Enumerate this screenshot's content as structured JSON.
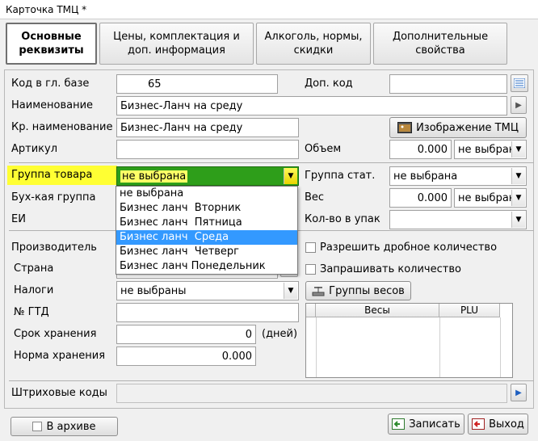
{
  "window": {
    "title": "Карточка ТМЦ *"
  },
  "tabs": [
    {
      "label_1": "Основные",
      "label_2": "реквизиты"
    },
    {
      "label_1": "Цены, комплектация и",
      "label_2": "доп.  информация"
    },
    {
      "label_1": "Алкоголь, нормы,",
      "label_2": "скидки"
    },
    {
      "label_1": "Дополнительные",
      "label_2": "свойства"
    }
  ],
  "fields": {
    "code_label": "Код в гл. базе",
    "code_value": "65",
    "addcode_label": "Доп. код",
    "addcode_value": "",
    "name_label": "Наименование",
    "name_value": "Бизнес-Ланч на среду",
    "short_label": "Кр. наименование",
    "short_value": "Бизнес-Ланч на среду",
    "image_button": "Изображение ТМЦ",
    "article_label": "Артикул",
    "article_value": "",
    "volume_label": "Объем",
    "volume_value": "0.000",
    "volume_unit": "не выбрана",
    "group_label": "Группа товара",
    "group_value": "не выбрана",
    "statgroup_label": "Группа стат.",
    "statgroup_value": "не выбрана",
    "accgroup_label": "Бух-кая группа",
    "weight_label": "Вес",
    "weight_value": "0.000",
    "weight_unit": "не выбрана",
    "ei_label": "ЕИ",
    "pack_label": "Кол-во в упак",
    "pack_value": "",
    "maker_label": "Производитель",
    "country_label": "Страна",
    "taxes_label": "Налоги",
    "taxes_value": "не выбраны",
    "gtd_label": "№ ГТД",
    "gtd_value": "",
    "shelf_label": "Срок хранения",
    "shelf_value": "0",
    "shelf_unit": "(дней)",
    "norm_label": "Норма хранения",
    "norm_value": "0.000",
    "barcodes_label": "Штриховые коды",
    "fraction_label": "Разрешить дробное количество",
    "askqty_label": "Запрашивать количество",
    "scale_groups_button": "Группы весов",
    "scales_header_1": "Весы",
    "scales_header_2": "PLU"
  },
  "dropdown": {
    "items": [
      "не выбрана",
      "Бизнес ланч  Вторник",
      "Бизнес ланч  Пятница",
      "Бизнес ланч  Среда",
      "Бизнес ланч  Четверг",
      "Бизнес ланч Понедельник"
    ],
    "selected_index": 3
  },
  "footer": {
    "archive_label": "В архиве",
    "save_button": "Записать",
    "exit_button": "Выход"
  },
  "colors": {
    "group_highlight": "#ffff33",
    "group_select_bg": "#2e9e1a",
    "dropdown_selected": "#3399ff"
  }
}
